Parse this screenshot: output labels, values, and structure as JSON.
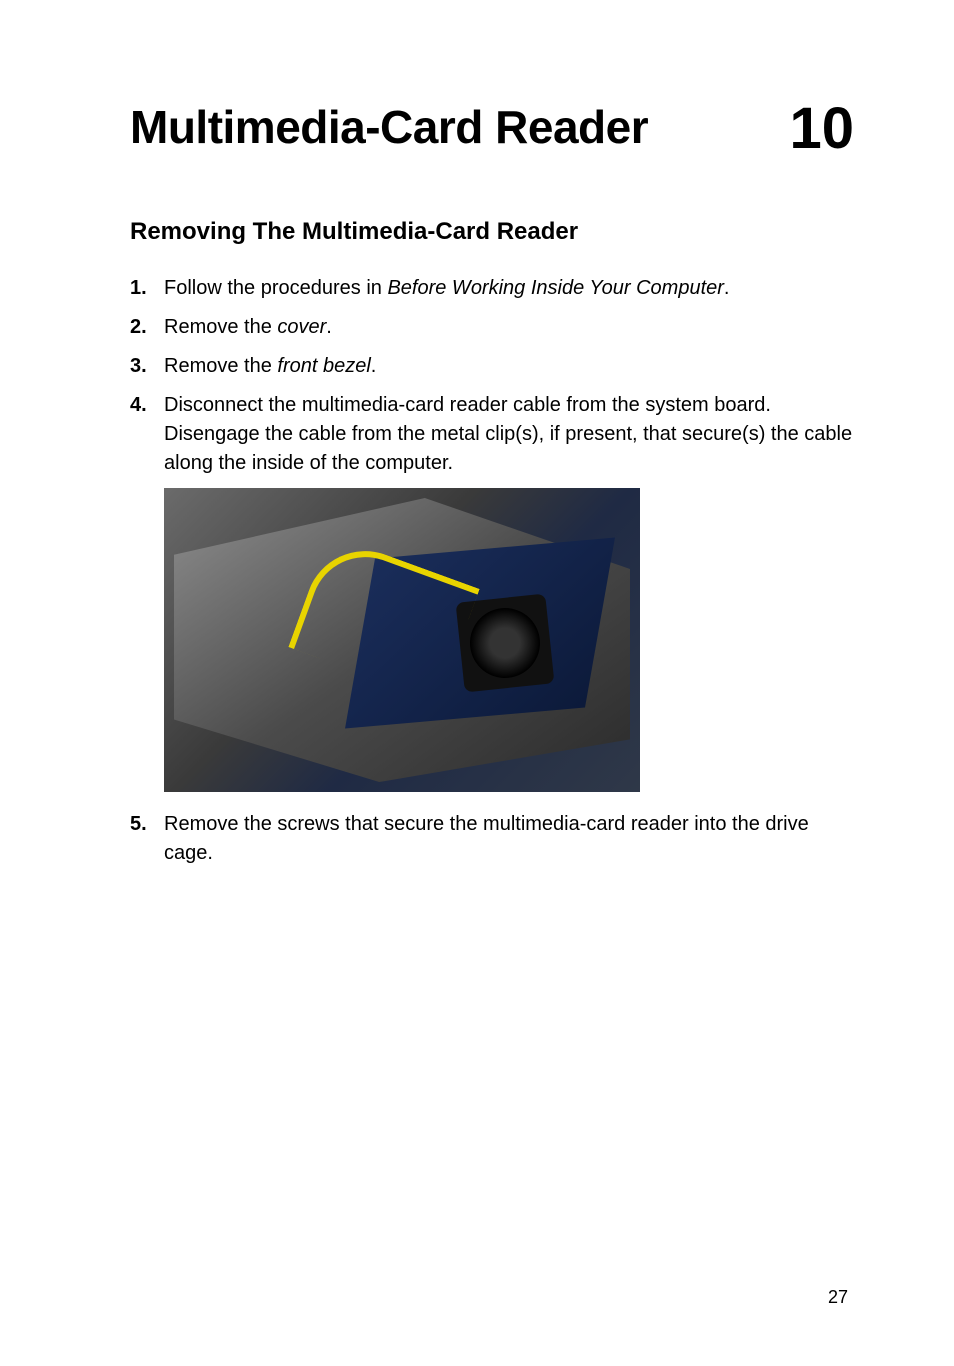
{
  "header": {
    "chapter_title": "Multimedia-Card Reader",
    "chapter_number": "10"
  },
  "section": {
    "title": "Removing The Multimedia-Card Reader"
  },
  "steps": [
    {
      "num": "1.",
      "prefix": "Follow the procedures in ",
      "xref": "Before Working Inside Your Computer",
      "suffix": "."
    },
    {
      "num": "2.",
      "prefix": "Remove the ",
      "xref": "cover",
      "suffix": "."
    },
    {
      "num": "3.",
      "prefix": "Remove the ",
      "xref": "front bezel",
      "suffix": "."
    },
    {
      "num": "4.",
      "prefix": "Disconnect the multimedia-card reader cable from the system board. Disengage the cable from the metal clip(s), if present, that secure(s) the cable along the inside of the computer.",
      "xref": "",
      "suffix": ""
    },
    {
      "num": "5.",
      "prefix": "Remove the screws that secure the multimedia-card reader into the drive cage.",
      "xref": "",
      "suffix": ""
    }
  ],
  "figure": {
    "alt": "Interior of a desktop computer showing the system board, CPU fan, drive cage, and a highlighted yellow cable path for the multimedia-card reader."
  },
  "page_number": "27"
}
